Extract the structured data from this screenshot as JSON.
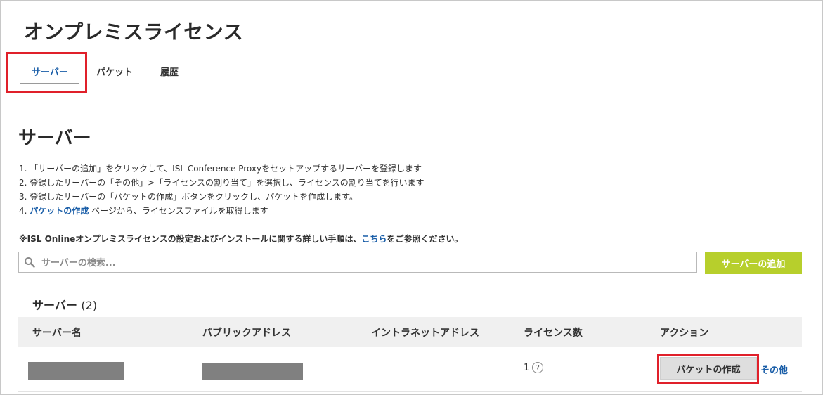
{
  "page": {
    "title": "オンプレミスライセンス"
  },
  "tabs": [
    {
      "label": "サーバー",
      "active": true
    },
    {
      "label": "パケット",
      "active": false
    },
    {
      "label": "履歴",
      "active": false
    }
  ],
  "section": {
    "title": "サーバー",
    "steps": {
      "s1": "1. 「サーバーの追加」をクリックして、ISL Conference Proxyをセットアップするサーバーを登録します",
      "s2": "2. 登録したサーバーの「その他」>「ライセンスの割り当て」を選択し、ライセンスの割り当てを行います",
      "s3": "3. 登録したサーバーの「パケットの作成」ボタンをクリックし、パケットを作成します。",
      "s4_prefix": "4. ",
      "s4_link": "パケットの作成",
      "s4_suffix": " ページから、ライセンスファイルを取得します"
    },
    "note": {
      "prefix": "※ISL Onlineオンプレミスライセンスの設定およびインストールに関する詳しい手順は、",
      "link": "こちら",
      "suffix": "をご参照ください。"
    }
  },
  "search": {
    "placeholder": "サーバーの検索..."
  },
  "toolbar": {
    "add_label": "サーバーの追加"
  },
  "server_list": {
    "title": "サーバー",
    "count": "(2)",
    "columns": [
      "サーバー名",
      "パブリックアドレス",
      "イントラネットアドレス",
      "ライセンス数",
      "アクション"
    ],
    "rows": [
      {
        "license_count": "1",
        "help": "?",
        "packet_label": "パケットの作成",
        "other_label": "その他"
      }
    ]
  },
  "colors": {
    "accent_link": "#1a5ea8",
    "add_button": "#b7cf2c",
    "highlight": "#e0202a"
  }
}
